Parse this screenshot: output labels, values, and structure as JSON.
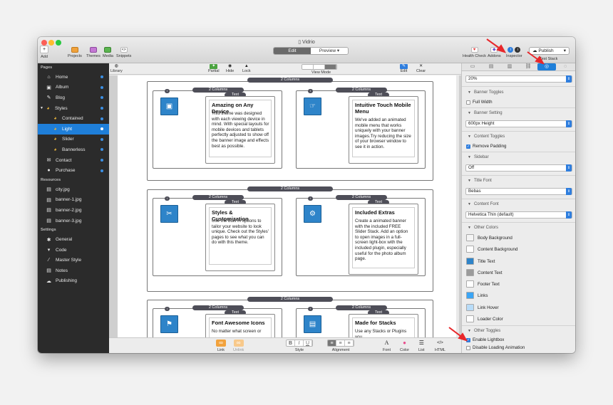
{
  "window": {
    "title": "Vidrio"
  },
  "toolbar": {
    "add": "Add",
    "projects": "Projects",
    "themes": "Themes",
    "media": "Media",
    "snippets": "Snippets",
    "mode_edit": "Edit",
    "mode_preview": "Preview",
    "health_check": "Health Check",
    "addons": "Addons",
    "inspector": "Inspector",
    "publish": "Publish",
    "test_stack": "Test Stack"
  },
  "sidebar": {
    "pages_header": "Pages",
    "pages": [
      {
        "label": "Home",
        "icon": "home-icon"
      },
      {
        "label": "Album",
        "icon": "image-icon"
      },
      {
        "label": "Blog",
        "icon": "pencil-icon"
      },
      {
        "label": "Styles",
        "icon": "palette-icon"
      },
      {
        "label": "Contained",
        "icon": "palette-icon"
      },
      {
        "label": "Light",
        "icon": "palette-icon"
      },
      {
        "label": "Slider",
        "icon": "palette-icon"
      },
      {
        "label": "Bannerless",
        "icon": "palette-icon"
      },
      {
        "label": "Contact",
        "icon": "envelope-icon"
      },
      {
        "label": "Purchase",
        "icon": "circle-icon"
      }
    ],
    "resources_header": "Resources",
    "resources": [
      {
        "label": "city.jpg"
      },
      {
        "label": "banner-1.jpg"
      },
      {
        "label": "banner-2.jpg"
      },
      {
        "label": "banner-3.jpg"
      }
    ],
    "settings_header": "Settings",
    "settings": [
      {
        "label": "General",
        "icon": "gear-icon"
      },
      {
        "label": "Code",
        "icon": "code-icon"
      },
      {
        "label": "Master Style",
        "icon": "wand-icon"
      },
      {
        "label": "Notes",
        "icon": "notes-icon"
      },
      {
        "label": "Publishing",
        "icon": "cloud-icon"
      }
    ]
  },
  "editbar": {
    "library": "Library",
    "partial": "Partial",
    "hide": "Hide",
    "lock": "Lock",
    "view_mode": "View Mode",
    "edit": "Edit",
    "clear": "Clear"
  },
  "canvas": {
    "outer_label": "2 Columns",
    "inner_label": "2 Columns",
    "text_label": "Text",
    "badge": "i",
    "blocks": [
      {
        "title": "Amazing on Any Device",
        "body": "This theme was designed with each viewing device in mind. With special layouts for mobile devices and tablets perfectly adjusted to show off the banner image and effects best as possible."
      },
      {
        "title": "Intuitive Touch Mobile Menu",
        "body": "We've added an animated mobile menu that works uniquely with your banner images.Try reducing the size of your browser window to see it in action."
      },
      {
        "title": "Styles & Customization",
        "body": "Use the built in options to tailor your website to look unique. Check out the Styles' pages to see what you can do with this theme."
      },
      {
        "title": "Included Extras",
        "body": "Create a animated banner with the included FREE Slider Stack. Add an option to open images in a full-screen light-box with the included plugin, especially useful for the photo album page."
      },
      {
        "title": "Font Awesome Icons",
        "body": "No matter what screen or"
      },
      {
        "title": "Made for Stacks",
        "body": "Use any Stacks or Plugins you"
      }
    ]
  },
  "bottombar": {
    "link": "Link",
    "unlink": "Unlink",
    "style": "Style",
    "alignment": "Alignment",
    "font": "Font",
    "color": "Color",
    "list": "List",
    "html": "HTML",
    "bold": "B",
    "italic": "I",
    "underline": "U",
    "font_glyph": "A",
    "html_glyph": "</>"
  },
  "inspector": {
    "top_value": "20%",
    "banner_toggles": "Banner Toggles",
    "full_width": "Full Width",
    "full_width_checked": false,
    "banner_setting": "Banner Setting",
    "banner_height": "600px Height",
    "content_toggles": "Content Toggles",
    "remove_padding": "Remove Padding",
    "remove_padding_checked": true,
    "sidebar": "Sidebar",
    "sidebar_value": "Off",
    "title_font": "Title Font",
    "title_font_value": "Bebas",
    "content_font": "Content Font",
    "content_font_value": "Helvetica Thin (default)",
    "other_colors": "Other Colors",
    "colors": [
      {
        "label": "Body Background",
        "color": "#f4f4f4"
      },
      {
        "label": "Content Background",
        "color": "#ffffff"
      },
      {
        "label": "Title Text",
        "color": "#2e84c9"
      },
      {
        "label": "Content Text",
        "color": "#9b9b9b"
      },
      {
        "label": "Footer Text",
        "color": "#ffffff"
      },
      {
        "label": "Links",
        "color": "#3ba5f5"
      },
      {
        "label": "Link Hover",
        "color": "#b8dcf8"
      },
      {
        "label": "Loader Color",
        "color": "#ffffff"
      }
    ],
    "other_toggles": "Other Toggles",
    "enable_lightbox": "Enable Lightbox",
    "enable_lightbox_checked": true,
    "disable_loading": "Disable Loading Animation",
    "disable_loading_checked": false
  },
  "colors": {
    "accent": "#1f7fd9",
    "sidebar_bg": "#2b2b2b",
    "annotation": "#e8272b",
    "stack_pill": "#4e4e58"
  }
}
